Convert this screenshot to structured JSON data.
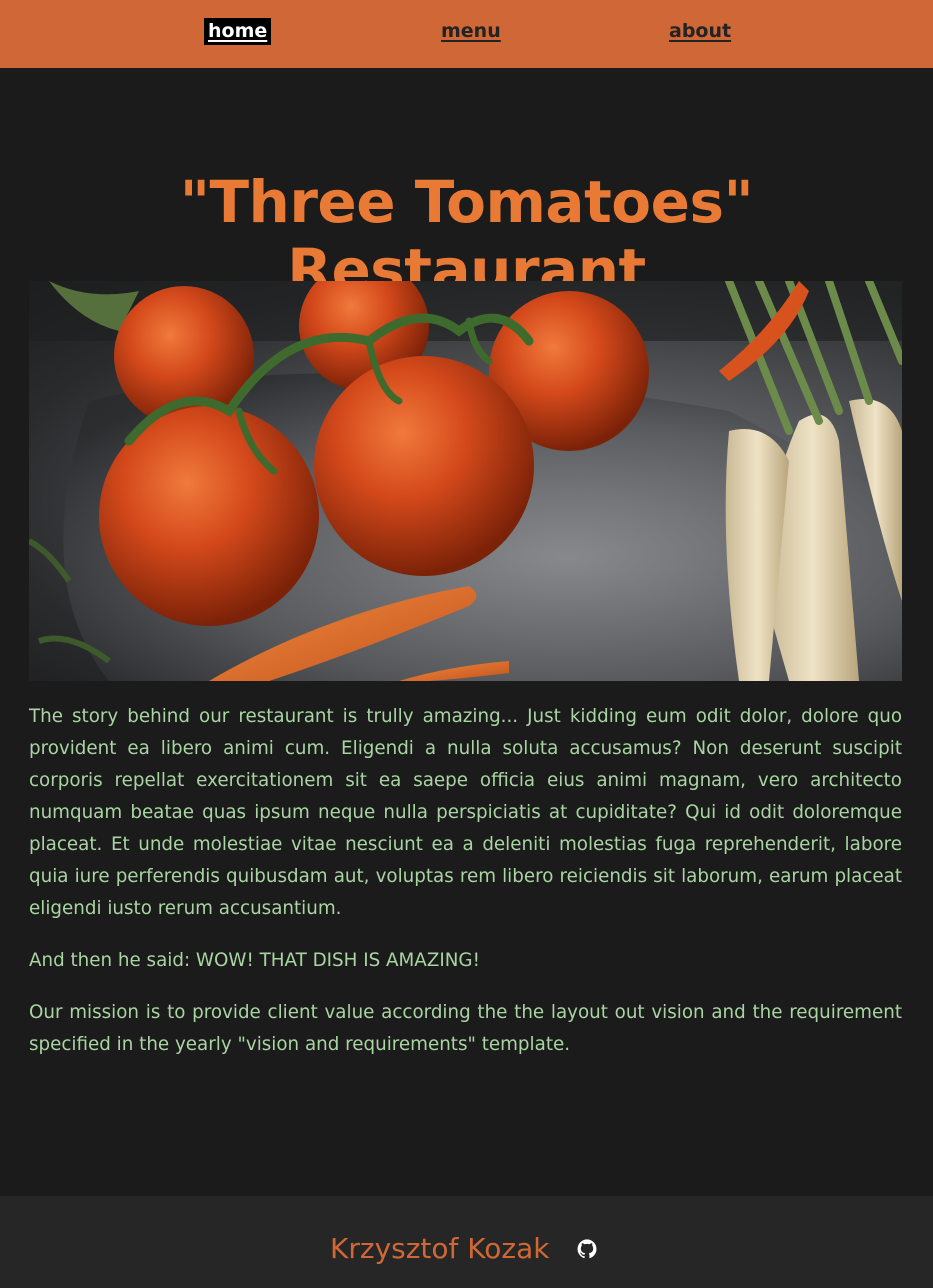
{
  "nav": {
    "items": [
      {
        "label": "home",
        "active": true
      },
      {
        "label": "menu",
        "active": false
      },
      {
        "label": "about",
        "active": false
      }
    ]
  },
  "main": {
    "title": "\"Three Tomatoes\" Restaurant",
    "hero_image": {
      "icon": "food-photo-tomatoes-carrots"
    },
    "paragraphs": [
      "The story behind our restaurant is trully amazing... Just kidding eum odit dolor, dolore quo provident ea libero animi cum. Eligendi a nulla soluta accusamus? Non deserunt suscipit corporis repellat exercitationem sit ea saepe officia eius animi magnam, vero architecto numquam beatae quas ipsum neque nulla perspiciatis at cupiditate? Qui id odit doloremque placeat. Et unde molestiae vitae nesciunt ea a deleniti molestias fuga reprehenderit, labore quia iure perferendis quibusdam aut, voluptas rem libero reiciendis sit laborum, earum placeat eligendi iusto rerum accusantium.",
      "And then he said: WOW! THAT DISH IS AMAZING!",
      "Our mission is to provide client value according the the layout out vision and the requirement specified in the yearly \"vision and requirements\" template."
    ]
  },
  "footer": {
    "author": "Krzysztof Kozak",
    "icon": "github-icon"
  },
  "colors": {
    "nav_bg": "#cf6836",
    "page_bg": "#1b1b1b",
    "title": "#e87a35",
    "body_text": "#a8d5a2",
    "footer_bg": "#262626"
  }
}
